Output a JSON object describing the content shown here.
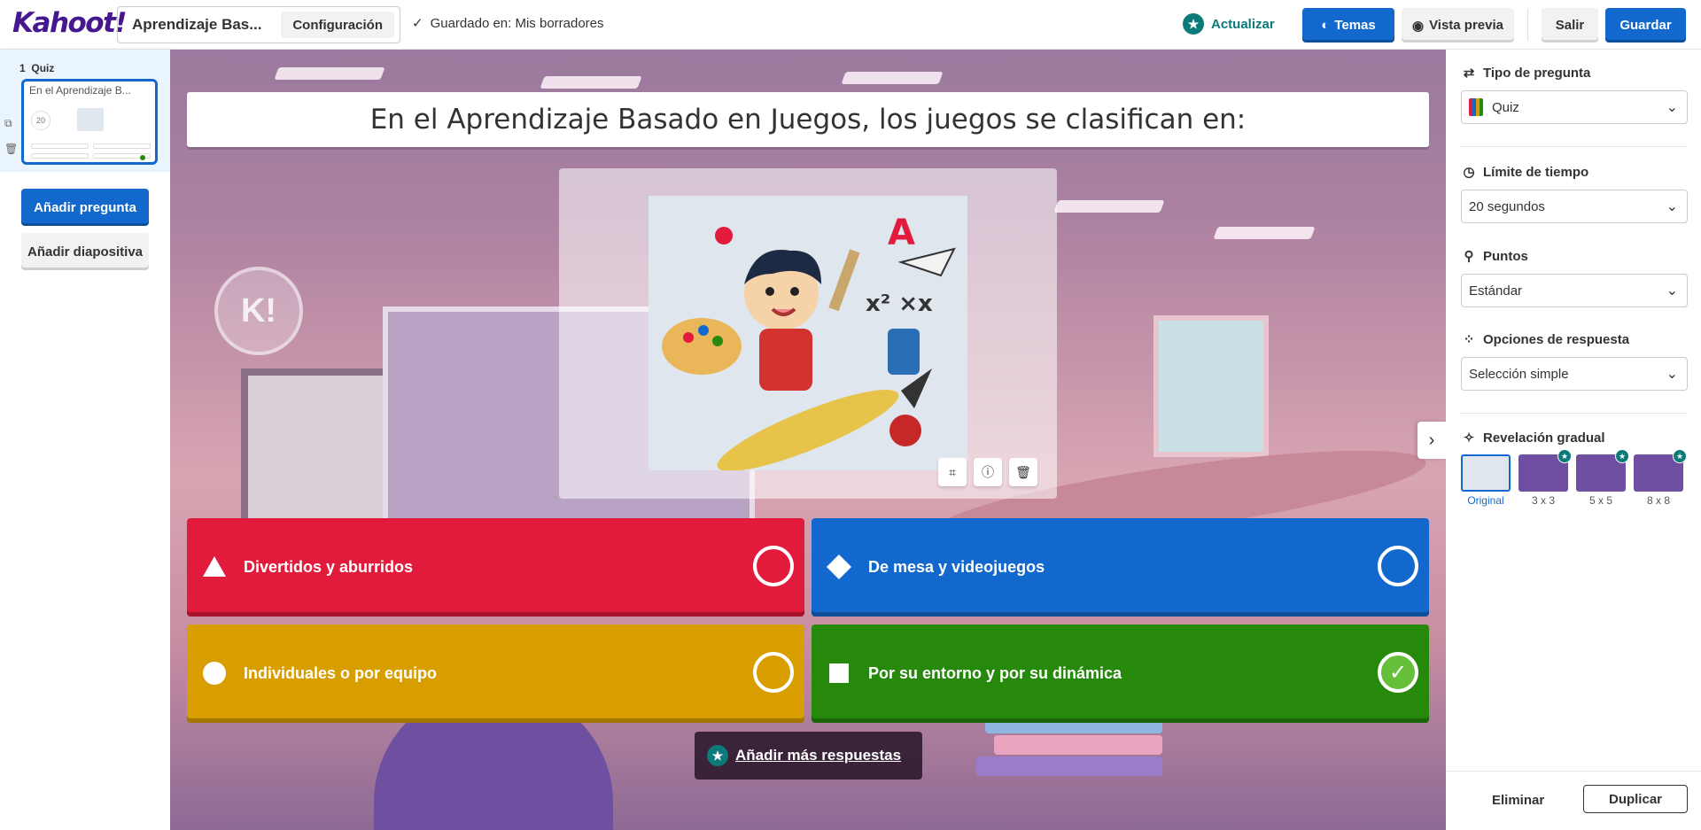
{
  "header": {
    "logo": "Kahoot!",
    "title": "Aprendizaje Bas...",
    "config_label": "Configuración",
    "saved_text": "Guardado en: Mis borradores",
    "upgrade_label": "Actualizar",
    "themes_label": "Temas",
    "preview_label": "Vista previa",
    "exit_label": "Salir",
    "save_label": "Guardar"
  },
  "sidebar": {
    "slide_index": "1",
    "slide_type": "Quiz",
    "thumb_title": "En el Aprendizaje B...",
    "thumb_timer": "20",
    "add_question_label": "Añadir pregunta",
    "add_slide_label": "Añadir diapositiva"
  },
  "editor": {
    "question": "En el Aprendizaje Basado en Juegos, los juegos se clasifican en:",
    "answers": [
      {
        "text": "Divertidos y aburridos",
        "color": "#e21b3c",
        "shape": "triangle",
        "correct": false
      },
      {
        "text": "De mesa y videojuegos",
        "color": "#1368ce",
        "shape": "diamond",
        "correct": false
      },
      {
        "text": "Individuales o por equipo",
        "color": "#d89e00",
        "shape": "circle",
        "correct": false
      },
      {
        "text": "Por su entorno y por su dinámica",
        "color": "#26890c",
        "shape": "square",
        "correct": true
      }
    ],
    "add_more_label": "Añadir más respuestas"
  },
  "settings": {
    "question_type": {
      "label": "Tipo de pregunta",
      "value": "Quiz"
    },
    "time_limit": {
      "label": "Límite de tiempo",
      "value": "20 segundos"
    },
    "points": {
      "label": "Puntos",
      "value": "Estándar"
    },
    "answer_options": {
      "label": "Opciones de respuesta",
      "value": "Selección simple"
    },
    "gradual_reveal": {
      "label": "Revelación gradual",
      "options": [
        "Original",
        "3 x 3",
        "5 x 5",
        "8 x 8"
      ],
      "selected": "Original"
    },
    "delete_label": "Eliminar",
    "duplicate_label": "Duplicar"
  },
  "colors": {
    "brand": "#46178f",
    "primary": "#1368ce",
    "premium": "#0b7a79"
  }
}
